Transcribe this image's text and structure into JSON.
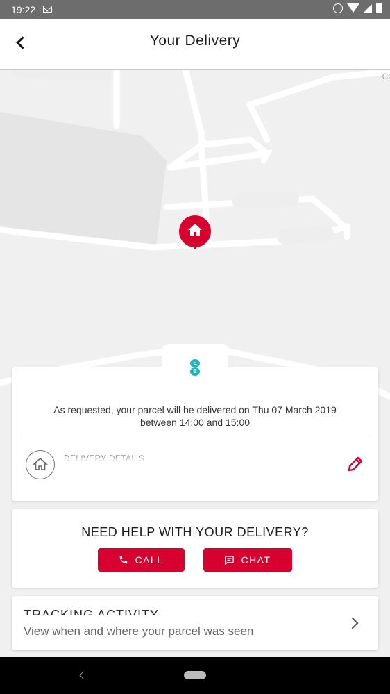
{
  "status_bar": {
    "time": "19:22"
  },
  "header": {
    "title": "Your Delivery"
  },
  "map": {
    "partial_label": "Cl"
  },
  "delivery_card": {
    "message_line1": "As requested, your parcel will be delivered on Thu 07 March 2019",
    "message_line2": "between 14:00 and 15:00",
    "details_title": "DELIVERY DETAILS"
  },
  "help_card": {
    "title": "NEED HELP WITH YOUR DELIVERY?",
    "call_label": "CALL",
    "chat_label": "CHAT"
  },
  "tracking_card": {
    "title": "TRACKING ACTIVITY",
    "subtitle": "View when and where your parcel was seen"
  },
  "colors": {
    "accent": "#d8002f",
    "ee_teal": "#1ab6c1"
  }
}
